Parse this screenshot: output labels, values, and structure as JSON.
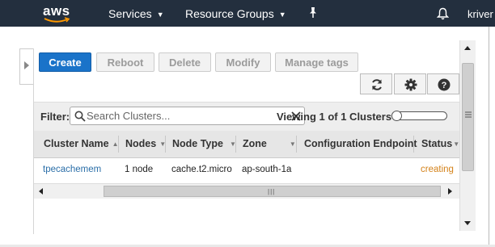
{
  "navbar": {
    "logo_text": "aws",
    "services_label": "Services",
    "resource_groups_label": "Resource Groups",
    "user_label": "kriver",
    "bg_color": "#232f3e"
  },
  "toolbar": {
    "create_label": "Create",
    "reboot_label": "Reboot",
    "delete_label": "Delete",
    "modify_label": "Modify",
    "manage_tags_label": "Manage tags"
  },
  "icons": {
    "refresh": "refresh-icon",
    "settings": "gear-icon",
    "help": "help-icon"
  },
  "filter": {
    "label": "Filter:",
    "placeholder": "Search Clusters...",
    "value": "",
    "viewing_text": "Viewing 1 of 1 Clusters"
  },
  "table": {
    "columns": [
      "Cluster Name",
      "Nodes",
      "Node Type",
      "Zone",
      "Configuration Endpoint",
      "Status"
    ],
    "rows": [
      {
        "cluster_name": "tpecachemem",
        "nodes": "1 node",
        "node_type": "cache.t2.micro",
        "zone": "ap-south-1a",
        "endpoint": "",
        "status": "creating"
      }
    ]
  },
  "colors": {
    "primary_button": "#1a73c9",
    "link": "#2a6ea8",
    "status_creating": "#d4821a"
  }
}
